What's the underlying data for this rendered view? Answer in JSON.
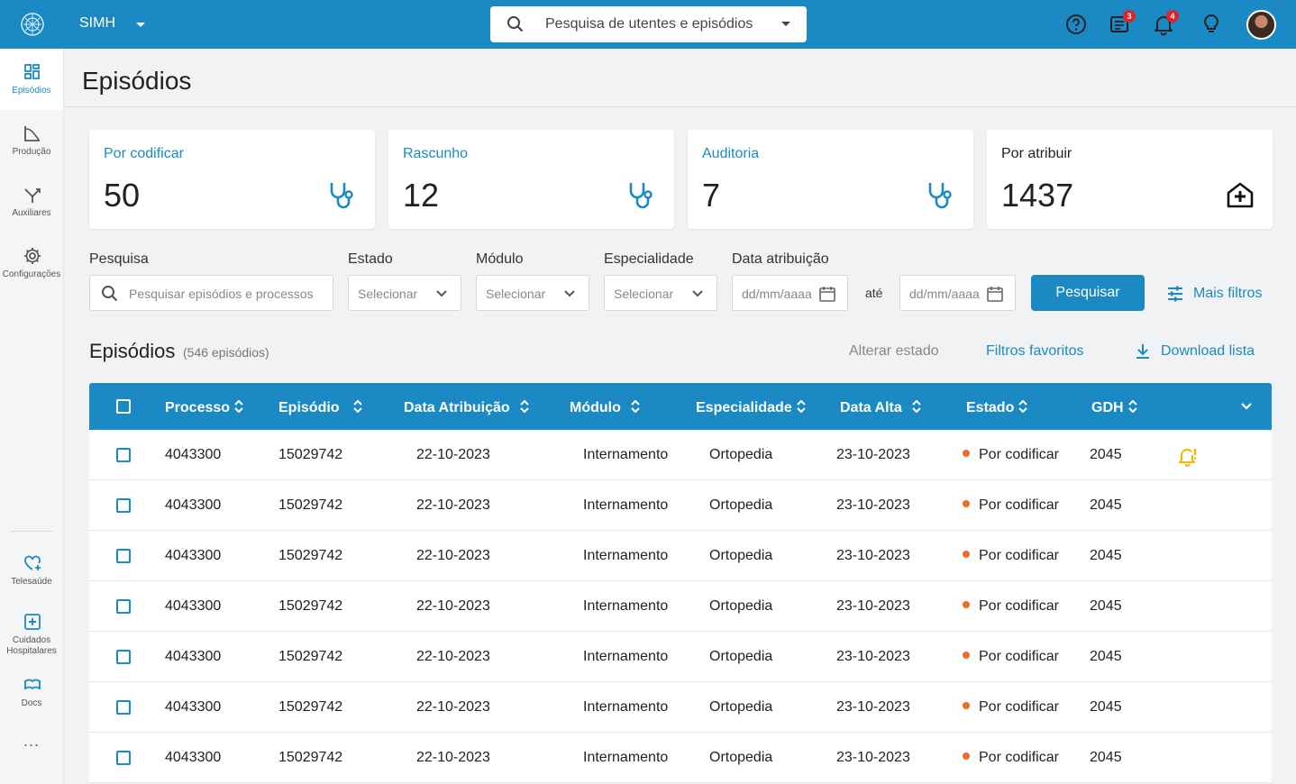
{
  "topbar": {
    "app_name": "SIMH",
    "search_placeholder": "Pesquisa de utentes e episódios",
    "messages_badge": "3",
    "notifications_badge": "4",
    "icons": [
      "help-icon",
      "messages-icon",
      "notifications-icon",
      "lightbulb-icon"
    ]
  },
  "sidebar": {
    "items": [
      {
        "label": "Episódios",
        "icon": "grid-icon"
      },
      {
        "label": "Produção",
        "icon": "chart-icon"
      },
      {
        "label": "Auxiliares",
        "icon": "merge-icon"
      },
      {
        "label": "Configurações",
        "icon": "gear-icon"
      }
    ],
    "bottom_items": [
      {
        "label": "Telesaúde",
        "icon": "heart-plus-icon"
      },
      {
        "label": "Cuidados Hospitalares",
        "icon": "hospital-plus-icon"
      },
      {
        "label": "Docs",
        "icon": "docs-icon"
      }
    ],
    "more": "..."
  },
  "page": {
    "title": "Episódios"
  },
  "cards": [
    {
      "label": "Por codificar",
      "value": "50",
      "icon": "stethoscope-icon"
    },
    {
      "label": "Rascunho",
      "value": "12",
      "icon": "stethoscope-icon"
    },
    {
      "label": "Auditoria",
      "value": "7",
      "icon": "stethoscope-icon"
    },
    {
      "label": "Por atribuir",
      "value": "1437",
      "icon": "house-plus-icon"
    }
  ],
  "filters": {
    "search_label": "Pesquisa",
    "search_placeholder": "Pesquisar episódios e processos",
    "estado_label": "Estado",
    "estado_value": "Selecionar",
    "modulo_label": "Módulo",
    "modulo_value": "Selecionar",
    "especialidade_label": "Especialidade",
    "especialidade_value": "Selecionar",
    "data_label": "Data atribuição",
    "date_from_placeholder": "dd/mm/aaaa",
    "date_sep": "até",
    "date_to_placeholder": "dd/mm/aaaa",
    "search_button": "Pesquisar",
    "more_filters": "Mais filtros"
  },
  "list": {
    "title": "Episódios",
    "count": "(546 episódios)",
    "change_state": "Alterar estado",
    "favorite_filters": "Filtros favoritos",
    "download": "Download lista"
  },
  "table": {
    "columns": [
      "Processo",
      "Episódio",
      "Data Atribuição",
      "Módulo",
      "Especialidade",
      "Data Alta",
      "Estado",
      "GDH"
    ],
    "rows": [
      {
        "processo": "4043300",
        "episodio": "15029742",
        "data_atribuicao": "22-10-2023",
        "modulo": "Internamento",
        "especialidade": "Ortopedia",
        "data_alta": "23-10-2023",
        "estado": "Por codificar",
        "gdh": "2045",
        "alert": true
      },
      {
        "processo": "4043300",
        "episodio": "15029742",
        "data_atribuicao": "22-10-2023",
        "modulo": "Internamento",
        "especialidade": "Ortopedia",
        "data_alta": "23-10-2023",
        "estado": "Por codificar",
        "gdh": "2045",
        "alert": false
      },
      {
        "processo": "4043300",
        "episodio": "15029742",
        "data_atribuicao": "22-10-2023",
        "modulo": "Internamento",
        "especialidade": "Ortopedia",
        "data_alta": "23-10-2023",
        "estado": "Por codificar",
        "gdh": "2045",
        "alert": false
      },
      {
        "processo": "4043300",
        "episodio": "15029742",
        "data_atribuicao": "22-10-2023",
        "modulo": "Internamento",
        "especialidade": "Ortopedia",
        "data_alta": "23-10-2023",
        "estado": "Por codificar",
        "gdh": "2045",
        "alert": false
      },
      {
        "processo": "4043300",
        "episodio": "15029742",
        "data_atribuicao": "22-10-2023",
        "modulo": "Internamento",
        "especialidade": "Ortopedia",
        "data_alta": "23-10-2023",
        "estado": "Por codificar",
        "gdh": "2045",
        "alert": false
      },
      {
        "processo": "4043300",
        "episodio": "15029742",
        "data_atribuicao": "22-10-2023",
        "modulo": "Internamento",
        "especialidade": "Ortopedia",
        "data_alta": "23-10-2023",
        "estado": "Por codificar",
        "gdh": "2045",
        "alert": false
      },
      {
        "processo": "4043300",
        "episodio": "15029742",
        "data_atribuicao": "22-10-2023",
        "modulo": "Internamento",
        "especialidade": "Ortopedia",
        "data_alta": "23-10-2023",
        "estado": "Por codificar",
        "gdh": "2045",
        "alert": false
      }
    ]
  },
  "colors": {
    "primary": "#1b8ac4",
    "status_por_codificar": "#e8712e",
    "alert": "#f2b705",
    "badge": "#e02424"
  }
}
